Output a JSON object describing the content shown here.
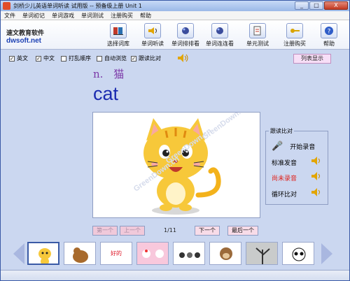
{
  "window": {
    "title": "剑桥少儿英语单词听读 试用版 -- 预备级上册 Unit 1",
    "controls": [
      "_",
      "□",
      "X"
    ]
  },
  "menu": [
    "文件",
    "单词初记",
    "单词游戏",
    "单词测试",
    "注册购买",
    "帮助"
  ],
  "brand": {
    "name": "速文教育软件",
    "site": "dwsoft.net"
  },
  "toolbar": [
    {
      "label": "选择词库",
      "icon": "library-icon"
    },
    {
      "label": "单词听读",
      "icon": "speaker-icon"
    },
    {
      "label": "单词排排看",
      "icon": "ball-icon"
    },
    {
      "label": "单词连连看",
      "icon": "ball-icon"
    },
    {
      "label": "单元测试",
      "icon": "test-icon"
    },
    {
      "label": "注册购买",
      "icon": "key-icon"
    },
    {
      "label": "帮助",
      "icon": "help-icon"
    }
  ],
  "options": [
    {
      "label": "英文",
      "checked": true
    },
    {
      "label": "中文",
      "checked": true
    },
    {
      "label": "打乱顺序",
      "checked": false
    },
    {
      "label": "自动浏览",
      "checked": false
    },
    {
      "label": "跟读比对",
      "checked": true
    }
  ],
  "list_button": "列表显示",
  "entry": {
    "pos": "n.",
    "meaning": "猫",
    "word": "cat"
  },
  "compare_panel": {
    "title": "跟读比对",
    "rows": [
      {
        "label": "开始录音",
        "icon": "microphone-icon",
        "color": "#000000"
      },
      {
        "label": "标准发音",
        "icon": "speaker-icon",
        "color": "#000000"
      },
      {
        "label": "尚未录音",
        "icon": "speaker-icon",
        "color": "#e0201a"
      },
      {
        "label": "循环比对",
        "icon": "speaker-icon",
        "color": "#000000"
      }
    ]
  },
  "nav": {
    "first": "第一个",
    "prev": "上一个",
    "counter": "1/11",
    "next": "下一个",
    "last": "最后一个"
  },
  "watermark": [
    "GreenDown.cn",
    "GreenDown.cn",
    "GreenDown.cn"
  ],
  "thumbnails": [
    {
      "name": "cat",
      "selected": true
    },
    {
      "name": "dog",
      "selected": false
    },
    {
      "name": "good",
      "text": "好的",
      "selected": false
    },
    {
      "name": "kitty",
      "selected": false
    },
    {
      "name": "group",
      "selected": false
    },
    {
      "name": "monkey",
      "selected": false
    },
    {
      "name": "tree",
      "selected": false
    },
    {
      "name": "panda",
      "selected": false
    }
  ]
}
